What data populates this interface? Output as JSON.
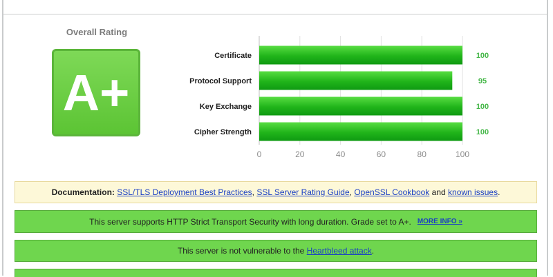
{
  "overall": {
    "label": "Overall Rating",
    "grade": "A+",
    "grade_color": "#6ad048"
  },
  "chart_data": {
    "type": "bar",
    "orientation": "horizontal",
    "categories": [
      "Certificate",
      "Protocol Support",
      "Key Exchange",
      "Cipher Strength"
    ],
    "values": [
      100,
      95,
      100,
      100
    ],
    "value_labels": [
      "100",
      "95",
      "100",
      "100"
    ],
    "xlim": [
      0,
      100
    ],
    "xticks": [
      0,
      20,
      40,
      60,
      80,
      100
    ],
    "xtick_labels": [
      "0",
      "20",
      "40",
      "60",
      "80",
      "100"
    ],
    "grid": true,
    "bar_color": "#20b41a",
    "value_color": "#47b84a"
  },
  "banners": {
    "documentation": {
      "prefix": "Documentation:",
      "link1": "SSL/TLS Deployment Best Practices",
      "sep1": ",",
      "link2": "SSL Server Rating Guide",
      "sep2": ",",
      "link3": "OpenSSL Cookbook",
      "and": "and",
      "link4": "known issues",
      "end": "."
    },
    "hsts": {
      "text": "This server supports HTTP Strict Transport Security with long duration. Grade set to A+.",
      "more": "MORE INFO »"
    },
    "heartbleed": {
      "prefix": "This server is not vulnerable to the",
      "link": "Heartbleed attack",
      "end": "."
    }
  },
  "colors": {
    "banner_green": "#6fd64e",
    "banner_doc": "#fdf8d8",
    "link": "#1a3fc4"
  }
}
